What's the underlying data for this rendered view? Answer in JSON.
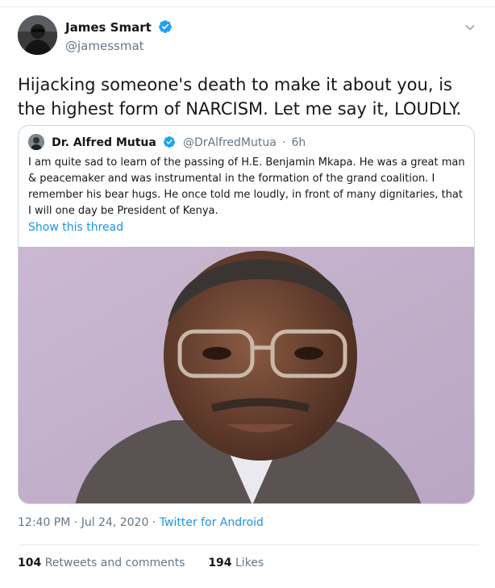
{
  "author": {
    "name": "James Smart",
    "handle": "@jamessmat",
    "verified_color": "#1da1f2"
  },
  "tweet_text": "Hijacking someone's death to make it about you, is the highest form of NARCISM. Let me say it, LOUDLY.",
  "quoted": {
    "name": "Dr. Alfred Mutua",
    "handle": "@DrAlfredMutua",
    "sep": "·",
    "time": "6h",
    "text": "I am quite sad to learn of the passing of H.E. Benjamin Mkapa. He was a great man & peacemaker and was instrumental in the formation of the grand coalition. I remember his bear hugs. He once told me loudly, in front of many dignitaries, that I will one day be President of Kenya.",
    "show_thread": "Show this thread"
  },
  "meta": {
    "time": "12:40 PM",
    "sep1": "·",
    "date": "Jul 24, 2020",
    "sep2": "·",
    "client": "Twitter for Android"
  },
  "stats": {
    "retweets_count": "104",
    "retweets_label": "Retweets and comments",
    "likes_count": "194",
    "likes_label": "Likes"
  },
  "colors": {
    "link": "#1b95e0",
    "secondary_text": "#657786",
    "border": "#ccd6dd"
  },
  "icons": {
    "verified": "verified-badge-icon",
    "caret": "chevron-down-icon"
  }
}
